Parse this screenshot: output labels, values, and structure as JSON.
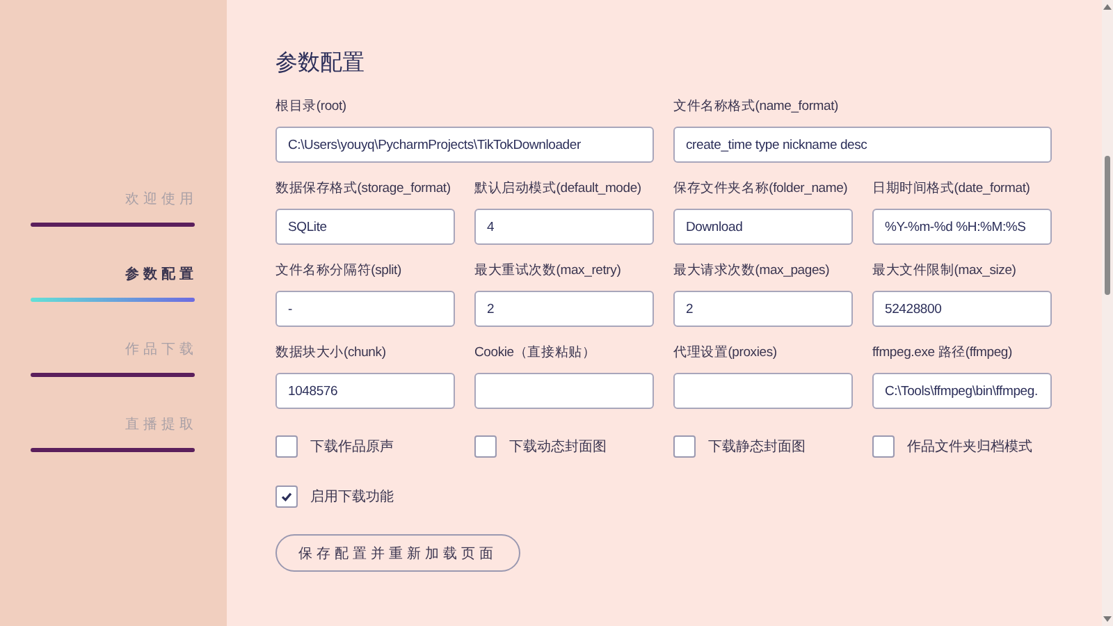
{
  "sidebar": {
    "items": [
      {
        "label": "欢迎使用",
        "selected": false
      },
      {
        "label": "参数配置",
        "selected": true
      },
      {
        "label": "作品下载",
        "selected": false
      },
      {
        "label": "直播提取",
        "selected": false
      }
    ]
  },
  "title": "参数配置",
  "field_rows": [
    [
      {
        "label": "根目录(root)",
        "value": "C:\\Users\\youyq\\PycharmProjects\\TikTokDownloader"
      },
      {
        "label": "文件名称格式(name_format)",
        "value": "create_time type nickname desc"
      }
    ],
    [
      {
        "label": "数据保存格式(storage_format)",
        "value": "SQLite"
      },
      {
        "label": "默认启动模式(default_mode)",
        "value": "4"
      },
      {
        "label": "保存文件夹名称(folder_name)",
        "value": "Download"
      },
      {
        "label": "日期时间格式(date_format)",
        "value": "%Y-%m-%d %H:%M:%S"
      }
    ],
    [
      {
        "label": "文件名称分隔符(split)",
        "value": "-"
      },
      {
        "label": "最大重试次数(max_retry)",
        "value": "2"
      },
      {
        "label": "最大请求次数(max_pages)",
        "value": "2"
      },
      {
        "label": "最大文件限制(max_size)",
        "value": "52428800"
      }
    ],
    [
      {
        "label": "数据块大小(chunk)",
        "value": "1048576"
      },
      {
        "label": "Cookie（直接粘贴）"
      },
      {
        "label": "代理设置(proxies)"
      },
      {
        "label": "ffmpeg.exe 路径(ffmpeg)",
        "value": "C:\\Tools\\ffmpeg\\bin\\ffmpeg."
      }
    ]
  ],
  "checkboxes": [
    {
      "label": "下载作品原声",
      "checked": false
    },
    {
      "label": "下载动态封面图",
      "checked": false
    },
    {
      "label": "下载静态封面图",
      "checked": false
    },
    {
      "label": "作品文件夹归档模式",
      "checked": false
    },
    {
      "label": "启用下载功能",
      "checked": true
    }
  ],
  "save_button": "保存配置并重新加载页面"
}
